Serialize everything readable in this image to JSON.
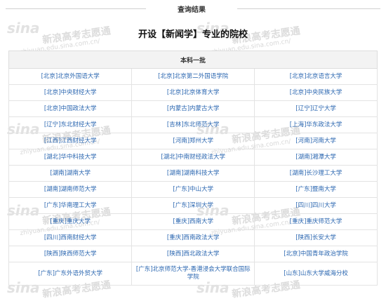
{
  "header": {
    "section_label": "查询结果"
  },
  "page_title": "开设【新闻学】专业的院校",
  "table": {
    "group_header": "本科一批",
    "rows": [
      [
        "[北京]北京外国语大学",
        "[北京]北京第二外国语学院",
        "[北京]北京语言大学"
      ],
      [
        "[北京]中央财经大学",
        "[北京]北京体育大学",
        "[北京]中央民族大学"
      ],
      [
        "[北京]中国政法大学",
        "[内蒙古]内蒙古大学",
        "[辽宁]辽宁大学"
      ],
      [
        "[辽宁]东北财经大学",
        "[吉林]东北师范大学",
        "[上海]华东政法大学"
      ],
      [
        "[江西]江西财经大学",
        "[河南]郑州大学",
        "[河南]河南大学"
      ],
      [
        "[湖北]华中科技大学",
        "[湖北]中南财经政法大学",
        "[湖南]湘潭大学"
      ],
      [
        "[湖南]湖南大学",
        "[湖南]湖南科技大学",
        "[湖南]长沙理工大学"
      ],
      [
        "[湖南]湖南师范大学",
        "[广东]中山大学",
        "[广东]暨南大学"
      ],
      [
        "[广东]华南理工大学",
        "[广东]深圳大学",
        "[四川]四川大学"
      ],
      [
        "[重庆]重庆大学",
        "[重庆]西南大学",
        "[重庆]重庆师范大学"
      ],
      [
        "[四川]西南财经大学",
        "[重庆]西南政法大学",
        "[陕西]长安大学"
      ],
      [
        "[陕西]陕西师范大学",
        "[陕西]西北政法大学",
        "[北京]中国青年政治学院"
      ],
      [
        "[广东]广东外语外贸大学",
        "[广东]北京师范大学-香港浸会大学联合国际学院",
        "[山东]山东大学威海分校"
      ]
    ]
  },
  "watermark": {
    "logo": "sina",
    "text": "新浪高考志愿通",
    "url": "zhiyuan.edu.sina.com.cn/"
  }
}
